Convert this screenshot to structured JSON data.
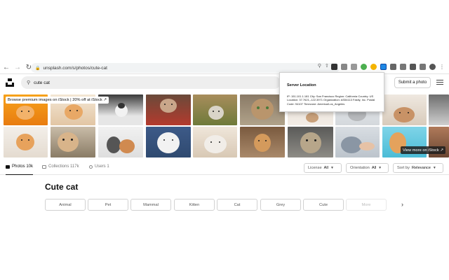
{
  "browser": {
    "url": "unsplash.com/s/photos/cute-cat",
    "back_icon": "arrow-left",
    "forward_icon": "arrow-right",
    "reload_icon": "reload"
  },
  "search": {
    "value": "cute cat",
    "icon": "search-icon"
  },
  "header": {
    "submit_label": "Submit a photo"
  },
  "popup": {
    "title": "Server Location",
    "details": "IP: 151.101.1.181 City: San Francisco Region: California Country: US Location: 37.7621,-122.3971 Organization: AS54113 Fastly, Inc. Postal Code: 94107 Timezone: America/Los_Angeles"
  },
  "banners": {
    "istock": "Browse premium images on iStock | 20% off at iStock ↗",
    "view_more": "View more on iStock ↗"
  },
  "tabs": [
    {
      "label": "Photos 10k",
      "icon": "image-icon"
    },
    {
      "label": "Collections 117k",
      "icon": "collection-icon"
    },
    {
      "label": "Users 1",
      "icon": "users-icon"
    }
  ],
  "filters": {
    "license_label": "License",
    "license_value": "All",
    "orientation_label": "Orientation",
    "orientation_value": "All",
    "sort_label": "Sort by",
    "sort_value": "Relevance"
  },
  "heading": "Cute cat",
  "chips": [
    "Animal",
    "Pet",
    "Mammal",
    "Kitten",
    "Cat",
    "Grey",
    "Cute",
    "More"
  ],
  "colors": {
    "chrome_bg": "#ffffff",
    "search_bg": "#eeeeee",
    "border": "#d1d1d1",
    "text_primary": "#111111",
    "text_muted": "#767676"
  }
}
